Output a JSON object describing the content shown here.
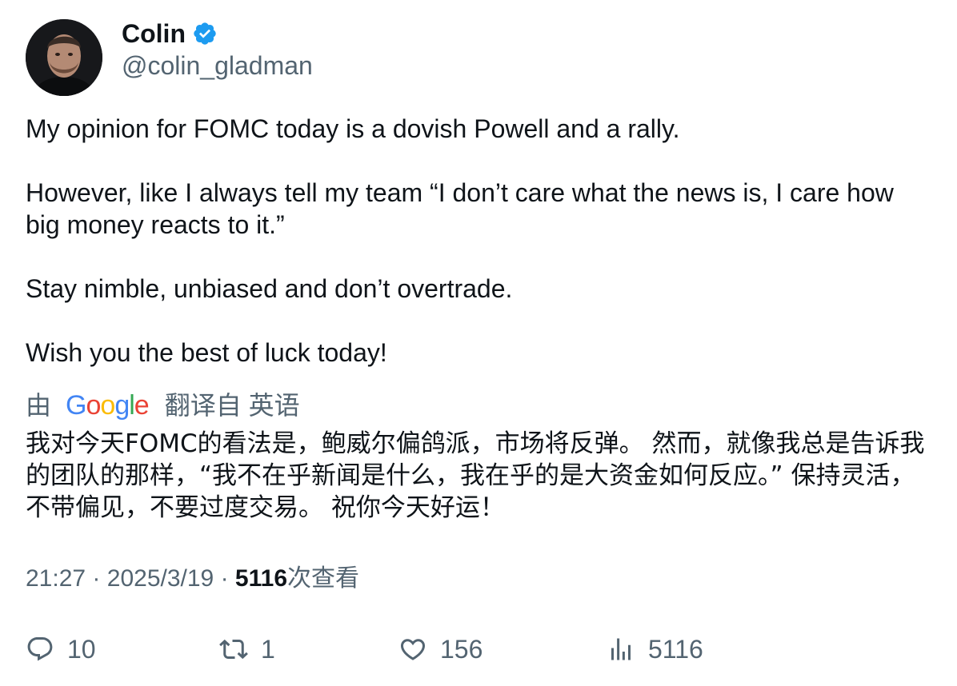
{
  "author": {
    "name": "Colin",
    "handle": "@colin_gladman",
    "verified": true,
    "verified_color": "#1d9bf0"
  },
  "tweet": {
    "paragraphs": [
      "My opinion for FOMC today is a dovish Powell and a rally.",
      "However, like I always tell my team “I don’t care what the news is, I care how big money reacts to it.”",
      "Stay nimble, unbiased and don’t overtrade.",
      "Wish you the best of luck today!"
    ]
  },
  "translation": {
    "prefix": "由",
    "provider": "Google",
    "label": "翻译自 英语",
    "text": "我对今天FOMC的看法是，鲍威尔偏鸽派，市场将反弹。 然而，就像我总是告诉我的团队的那样，“我不在乎新闻是什么，我在乎的是大资金如何反应。” 保持灵活，不带偏见，不要过度交易。 祝你今天好运！"
  },
  "meta": {
    "time": "21:27",
    "separator": "·",
    "date": "2025/3/19",
    "views_count": "5116",
    "views_label": "次查看"
  },
  "actions": {
    "reply": {
      "icon": "reply-icon",
      "count": "10"
    },
    "retweet": {
      "icon": "retweet-icon",
      "count": "1"
    },
    "like": {
      "icon": "heart-icon",
      "count": "156"
    },
    "views": {
      "icon": "views-chart-icon",
      "count": "5116"
    }
  },
  "colors": {
    "text": "#0f1419",
    "secondary": "#536471",
    "background": "#ffffff"
  }
}
